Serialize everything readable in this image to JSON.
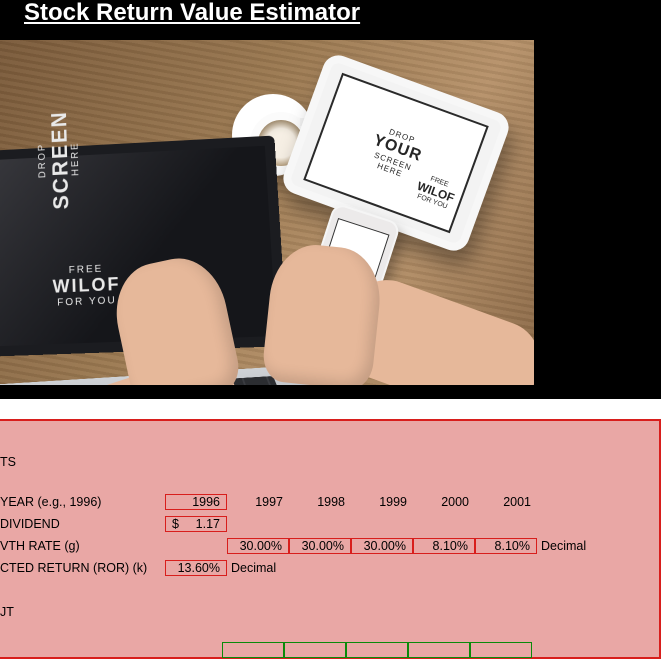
{
  "title": "Stock Return Value Estimator ",
  "hero_text": {
    "drop_line1": "DROP",
    "drop_line2": "YOUR",
    "drop_line3": "SCREEN",
    "drop_line4": "HERE",
    "brand_line1": "FREE",
    "brand_line2": "WILOF",
    "brand_line3": "FOR YOU"
  },
  "sheet": {
    "section_inputs": "TS",
    "labels": {
      "year": "YEAR (e.g., 1996)",
      "dividend": "DIVIDEND",
      "growth": "VTH RATE (g)",
      "ror": "CTED RETURN (ROR) (k)",
      "output": "JT"
    },
    "years": [
      "1996",
      "1997",
      "1998",
      "1999",
      "2000",
      "2001"
    ],
    "dividend_currency": "$",
    "dividend_value": "1.17",
    "growth_rates": [
      "30.00%",
      "30.00%",
      "30.00%",
      "8.10%",
      "8.10%"
    ],
    "ror_value": "13.60%",
    "decimal_note": "Decimal",
    "output_row_partial": [
      "",
      "",
      "",
      "",
      ""
    ]
  }
}
